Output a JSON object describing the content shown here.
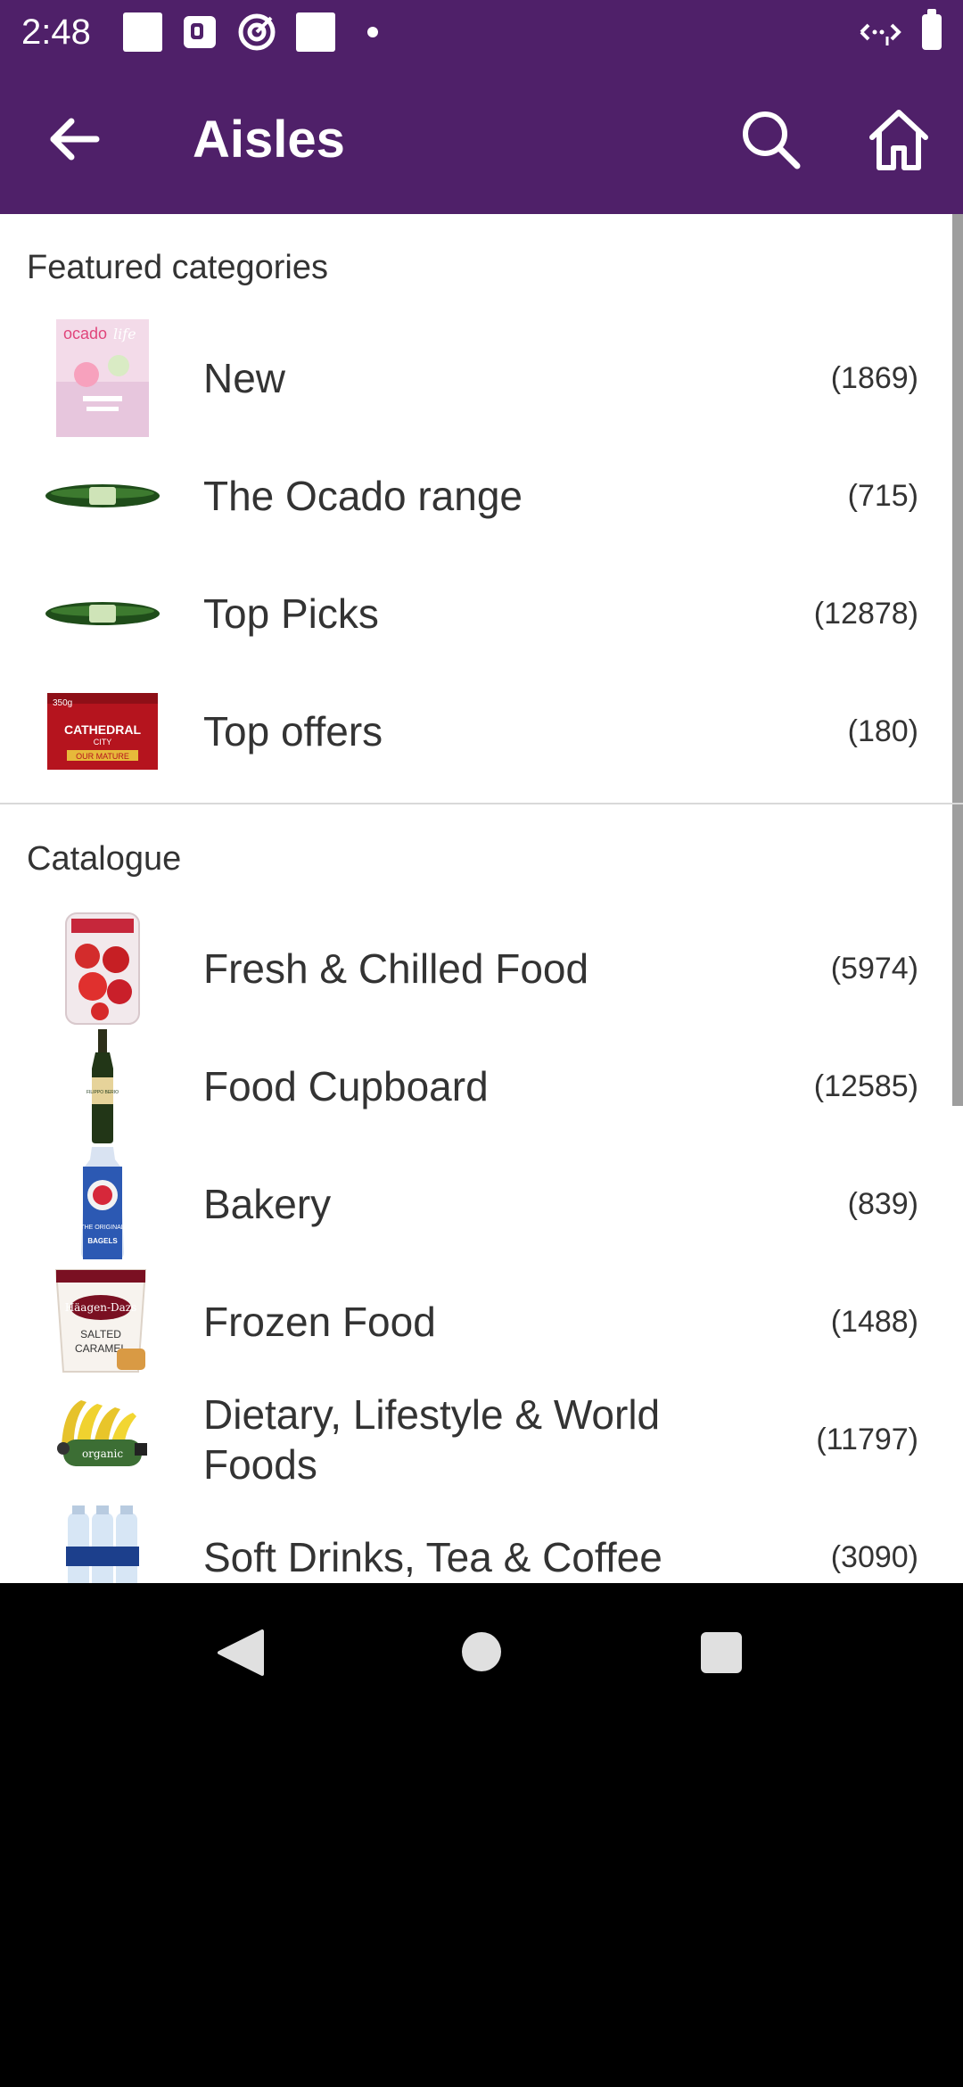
{
  "status_bar": {
    "time": "2:48",
    "icons": [
      "notification-square-icon",
      "news-icon",
      "target-icon",
      "notification-square-icon",
      "dot-icon",
      "wifi-icon",
      "battery-icon"
    ]
  },
  "app_bar": {
    "title": "Aisles",
    "back_icon": "arrow-left-icon",
    "search_icon": "search-icon",
    "home_icon": "home-icon",
    "background": "#4F2069"
  },
  "featured": {
    "heading": "Featured categories",
    "items": [
      {
        "label": "New",
        "count": "(1869)",
        "thumb": "magazine"
      },
      {
        "label": "The Ocado range",
        "count": "(715)",
        "thumb": "cucumber"
      },
      {
        "label": "Top Picks",
        "count": "(12878)",
        "thumb": "cucumber"
      },
      {
        "label": "Top offers",
        "count": "(180)",
        "thumb": "cheese"
      }
    ]
  },
  "catalogue": {
    "heading": "Catalogue",
    "items": [
      {
        "label": "Fresh & Chilled Food",
        "count": "(5974)",
        "thumb": "strawberries"
      },
      {
        "label": "Food Cupboard",
        "count": "(12585)",
        "thumb": "olive-oil"
      },
      {
        "label": "Bakery",
        "count": "(839)",
        "thumb": "bagels"
      },
      {
        "label": "Frozen Food",
        "count": "(1488)",
        "thumb": "ice-cream"
      },
      {
        "label": "Dietary, Lifestyle & World Foods",
        "count": "(11797)",
        "thumb": "bananas"
      },
      {
        "label": "Soft Drinks, Tea & Coffee",
        "count": "(3090)",
        "thumb": "water"
      }
    ]
  },
  "thumb_text": {
    "magazine_brand": "ocado",
    "magazine_sub": "life",
    "cheese_weight": "350g",
    "cheese_brand": "CATHEDRAL",
    "cheese_brand2": "CITY",
    "cheese_type": "OUR MATURE",
    "oil_brand": "FILIPPO BERIO",
    "bagel_text": "THE ORIGINAL",
    "bagel_text2": "BAGELS",
    "icecream_brand": "Häagen-Dazs",
    "icecream_flavor1": "SALTED",
    "icecream_flavor2": "CARAMEL",
    "banana_label": "organic"
  },
  "nav_bar": {
    "back_icon": "triangle-back-icon",
    "home_icon": "circle-home-icon",
    "recents_icon": "square-recents-icon"
  }
}
